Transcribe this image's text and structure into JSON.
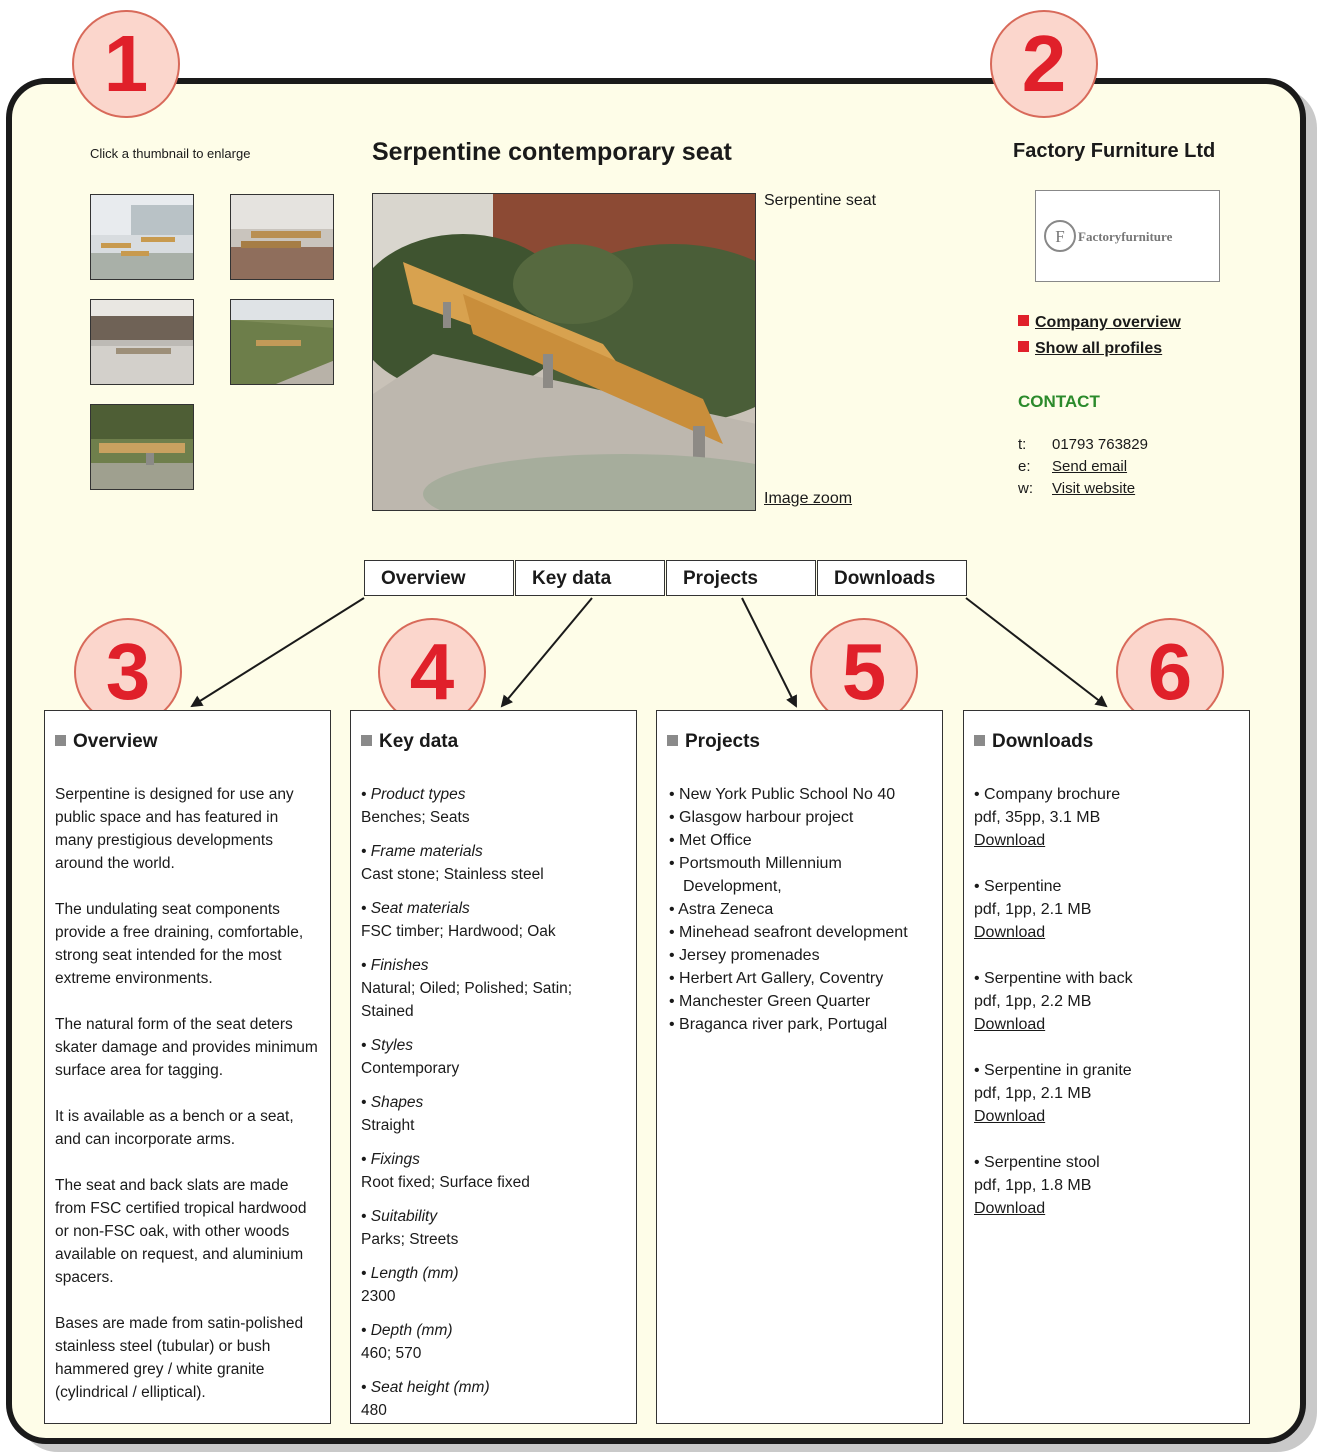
{
  "callouts": [
    "1",
    "2",
    "3",
    "4",
    "5",
    "6"
  ],
  "gallery": {
    "hint": "Click a thumbnail to enlarge",
    "thumbnails": [
      "thumbnail-1",
      "thumbnail-2",
      "thumbnail-3",
      "thumbnail-4",
      "thumbnail-5"
    ]
  },
  "product": {
    "title": "Serpentine contemporary seat",
    "image_caption": "Serpentine seat",
    "zoom_link": "Image zoom"
  },
  "company": {
    "name": "Factory Furniture Ltd",
    "logo_text": "Factoryfurniture",
    "logo_letter": "F",
    "links": [
      "Company overview",
      "Show all profiles"
    ],
    "contact_heading": "CONTACT",
    "contact": [
      {
        "label": "t:",
        "value": "01793 763829"
      },
      {
        "label": "e:",
        "value": "Send email"
      },
      {
        "label": "w:",
        "value": "Visit website"
      }
    ]
  },
  "tabs": [
    "Overview",
    "Key data",
    "Projects",
    "Downloads"
  ],
  "overview": {
    "heading": "Overview",
    "paragraphs": [
      "Serpentine is designed for use any public space and has featured in many prestigious developments around the world.",
      "The undulating seat components provide a free draining, comfortable, strong seat intended for the most extreme environments.",
      "The natural form of the seat deters skater damage and provides minimum surface area for tagging.",
      "It is available as a bench or a seat, and can incorporate arms.",
      "The seat and back slats are made from FSC certified tropical hardwood or non-FSC oak, with other woods available on request, and aluminium spacers.",
      "Bases are made from satin-polished stainless steel (tubular) or bush hammered grey / white granite (cylindrical / elliptical)."
    ]
  },
  "key_data": {
    "heading": "Key data",
    "items": [
      {
        "label": "• Product types",
        "value": "Benches; Seats"
      },
      {
        "label": "• Frame materials",
        "value": "Cast stone; Stainless steel"
      },
      {
        "label": "• Seat materials",
        "value": "FSC timber; Hardwood; Oak"
      },
      {
        "label": "• Finishes",
        "value": "Natural; Oiled; Polished; Satin; Stained"
      },
      {
        "label": "• Styles",
        "value": "Contemporary"
      },
      {
        "label": "• Shapes",
        "value": "Straight"
      },
      {
        "label": "• Fixings",
        "value": "Root fixed; Surface fixed"
      },
      {
        "label": "• Suitability",
        "value": "Parks; Streets"
      },
      {
        "label": "• Length (mm)",
        "value": "2300"
      },
      {
        "label": "• Depth (mm)",
        "value": "460; 570"
      },
      {
        "label": "• Seat height (mm)",
        "value": "480"
      }
    ]
  },
  "projects": {
    "heading": "Projects",
    "items": [
      "• New York Public School No 40",
      "• Glasgow harbour project",
      "• Met Office",
      "• Portsmouth Millennium Development,",
      "• Astra Zeneca",
      "• Minehead seafront development",
      "• Jersey promenades",
      "• Herbert Art Gallery, Coventry",
      "• Manchester Green Quarter",
      "• Braganca river park, Portugal"
    ]
  },
  "downloads": {
    "heading": "Downloads",
    "items": [
      {
        "name": "• Company brochure",
        "meta": "pdf, 35pp, 3.1 MB",
        "link": "Download"
      },
      {
        "name": "• Serpentine",
        "meta": "pdf, 1pp, 2.1 MB",
        "link": "Download"
      },
      {
        "name": "• Serpentine with back",
        "meta": "pdf, 1pp, 2.2 MB",
        "link": "Download"
      },
      {
        "name": "• Serpentine in granite",
        "meta": "pdf, 1pp, 2.1 MB",
        "link": "Download"
      },
      {
        "name": "• Serpentine stool",
        "meta": "pdf, 1pp, 1.8 MB",
        "link": "Download"
      }
    ]
  },
  "colors": {
    "callout_fill": "#fbd6cc",
    "callout_text": "#e0202a",
    "panel_bg": "#fefde8",
    "contact_green": "#2b8a2b",
    "bullet_red": "#e0202a"
  }
}
